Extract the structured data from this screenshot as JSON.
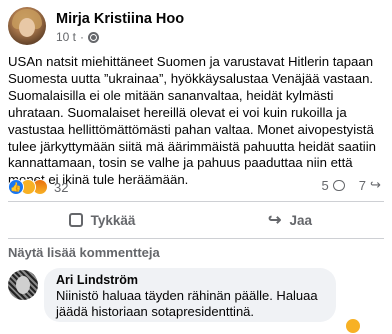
{
  "post": {
    "author": "Mirja Kristiina Hoo",
    "time": "10 t",
    "separator": "·",
    "paragraphs": [
      "USAn natsit miehittäneet Suomen ja varustavat Hitlerin tapaan Suomesta uutta ”ukrainaa”, hyökkäysalustaa Venäjää vastaan.",
      "Suomalaisilla ei ole mitään sananvaltaa, heidät kylmästi uhrataan. Suomalaiset hereillä olevat ei voi kuin rukoilla ja vastustaa hellittömättömästi pahan valtaa. Monet aivopestyistä tulee järkyttymään siitä mä äärimmäistä pahuutta heidät saatiin kannattamaan, tosin se valhe ja pahuus paaduttaa niin että monet ei ikinä tule heräämään."
    ]
  },
  "stats": {
    "reaction_count": "32",
    "comment_count": "5",
    "share_count": "7"
  },
  "reaction_icons": [
    "like-icon",
    "sad-icon",
    "angry-icon"
  ],
  "actions": {
    "like_label": "Tykkää",
    "share_label": "Jaa"
  },
  "comments_section": {
    "more_label": "Näytä lisää kommentteja",
    "comment": {
      "author": "Ari Lindström",
      "text": "Niinistö haluaa täyden rähinän päälle. Haluaa jäädä historiaan sotapresidenttinä."
    }
  },
  "colors": {
    "primary_text": "#050505",
    "secondary_text": "#65676b",
    "like_blue": "#1877f2",
    "bubble_bg": "#f0f2f5"
  }
}
